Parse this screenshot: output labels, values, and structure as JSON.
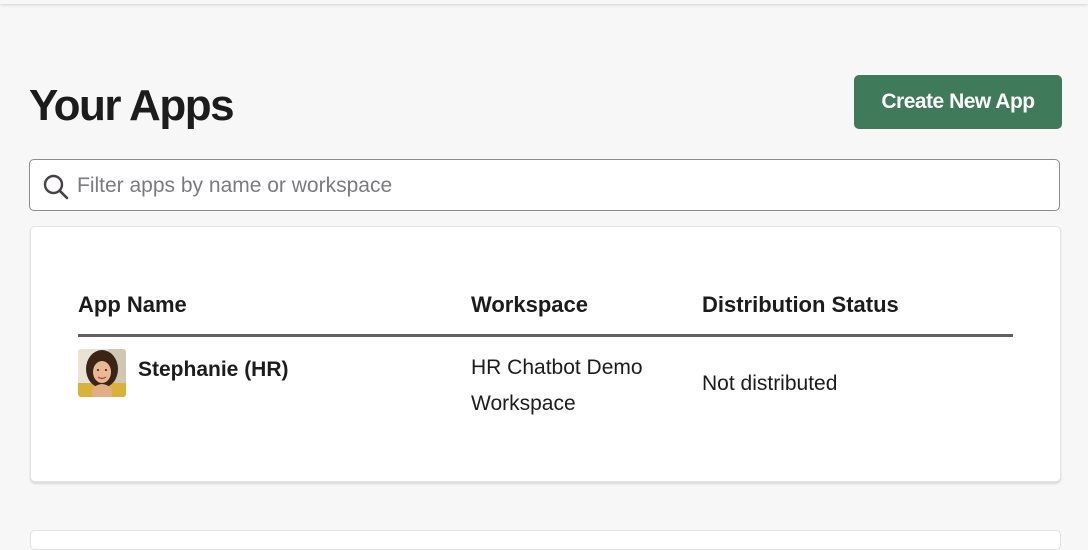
{
  "header": {
    "title": "Your Apps",
    "create_button_label": "Create New App"
  },
  "search": {
    "placeholder": "Filter apps by name or workspace",
    "value": "",
    "icon": "search-icon"
  },
  "table": {
    "columns": [
      "App Name",
      "Workspace",
      "Distribution Status"
    ],
    "rows": [
      {
        "app_name": "Stephanie (HR)",
        "workspace": "HR Chatbot Demo Workspace",
        "distribution_status": "Not distributed",
        "avatar": "avatar-photo"
      }
    ]
  },
  "colors": {
    "accent": "#3f7a5a",
    "background": "#f7f7f7",
    "card": "#ffffff",
    "rule": "#616061"
  }
}
